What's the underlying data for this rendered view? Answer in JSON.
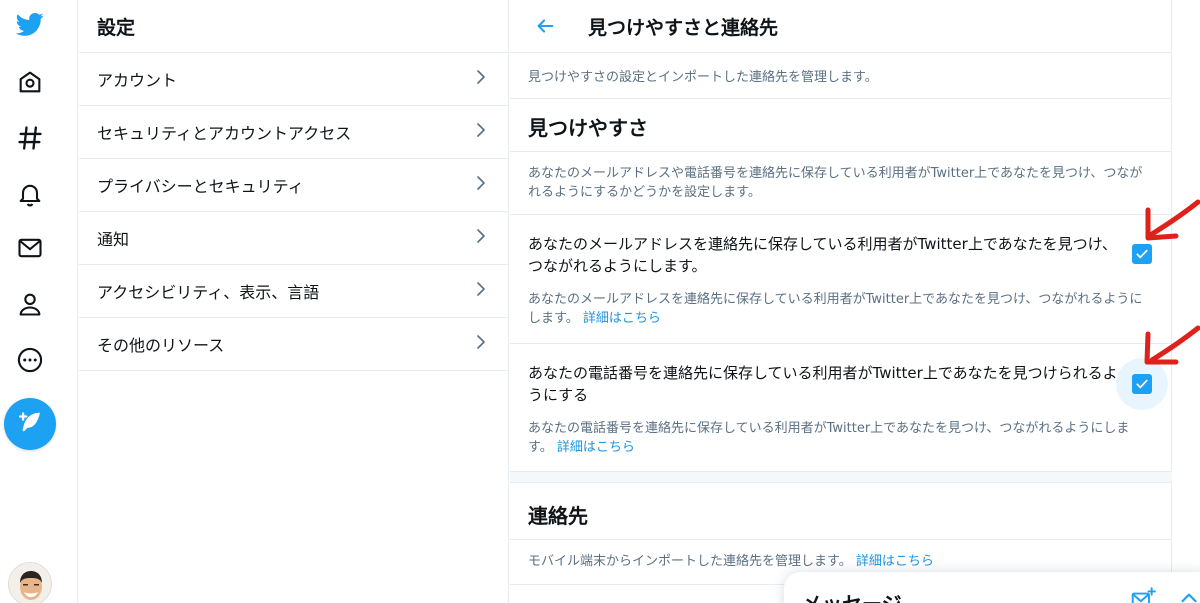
{
  "settings": {
    "title": "設定",
    "items": [
      {
        "label": "アカウント"
      },
      {
        "label": "セキュリティとアカウントアクセス"
      },
      {
        "label": "プライバシーとセキュリティ"
      },
      {
        "label": "通知"
      },
      {
        "label": "アクセシビリティ、表示、言語"
      },
      {
        "label": "その他のリソース"
      }
    ]
  },
  "detail": {
    "title": "見つけやすさと連絡先",
    "description": "見つけやすさの設定とインポートした連絡先を管理します。",
    "discoverability": {
      "title": "見つけやすさ",
      "description": "あなたのメールアドレスや電話番号を連絡先に保存している利用者がTwitter上であなたを見つけ、つながれるようにするかどうかを設定します。",
      "email_option": {
        "title": "あなたのメールアドレスを連絡先に保存している利用者がTwitter上であなたを見つけ、つながれるようにします。",
        "subtitle": "あなたのメールアドレスを連絡先に保存している利用者がTwitter上であなたを見つけ、つながれるようにします。",
        "link": "詳細はこちら",
        "checked": true
      },
      "phone_option": {
        "title": "あなたの電話番号を連絡先に保存している利用者がTwitter上であなたを見つけられるようにする",
        "subtitle": "あなたの電話番号を連絡先に保存している利用者がTwitter上であなたを見つけ、つながれるようにします。",
        "link": "詳細はこちら",
        "checked": true
      }
    },
    "contacts": {
      "title": "連絡先",
      "description": "モバイル端末からインポートした連絡先を管理します。",
      "link": "詳細はこちら"
    }
  },
  "messages": {
    "title": "メッセージ"
  },
  "colors": {
    "accent": "#1da1f2",
    "link": "#1b95e0",
    "annotation": "#e0201b"
  },
  "icons": [
    "twitter-logo-icon",
    "home-icon",
    "explore-hashtag-icon",
    "notifications-bell-icon",
    "messages-envelope-icon",
    "profile-icon",
    "more-icon",
    "compose-tweet-icon",
    "chevron-right-icon",
    "back-arrow-icon",
    "checkmark-icon",
    "new-message-icon",
    "collapse-icon"
  ]
}
